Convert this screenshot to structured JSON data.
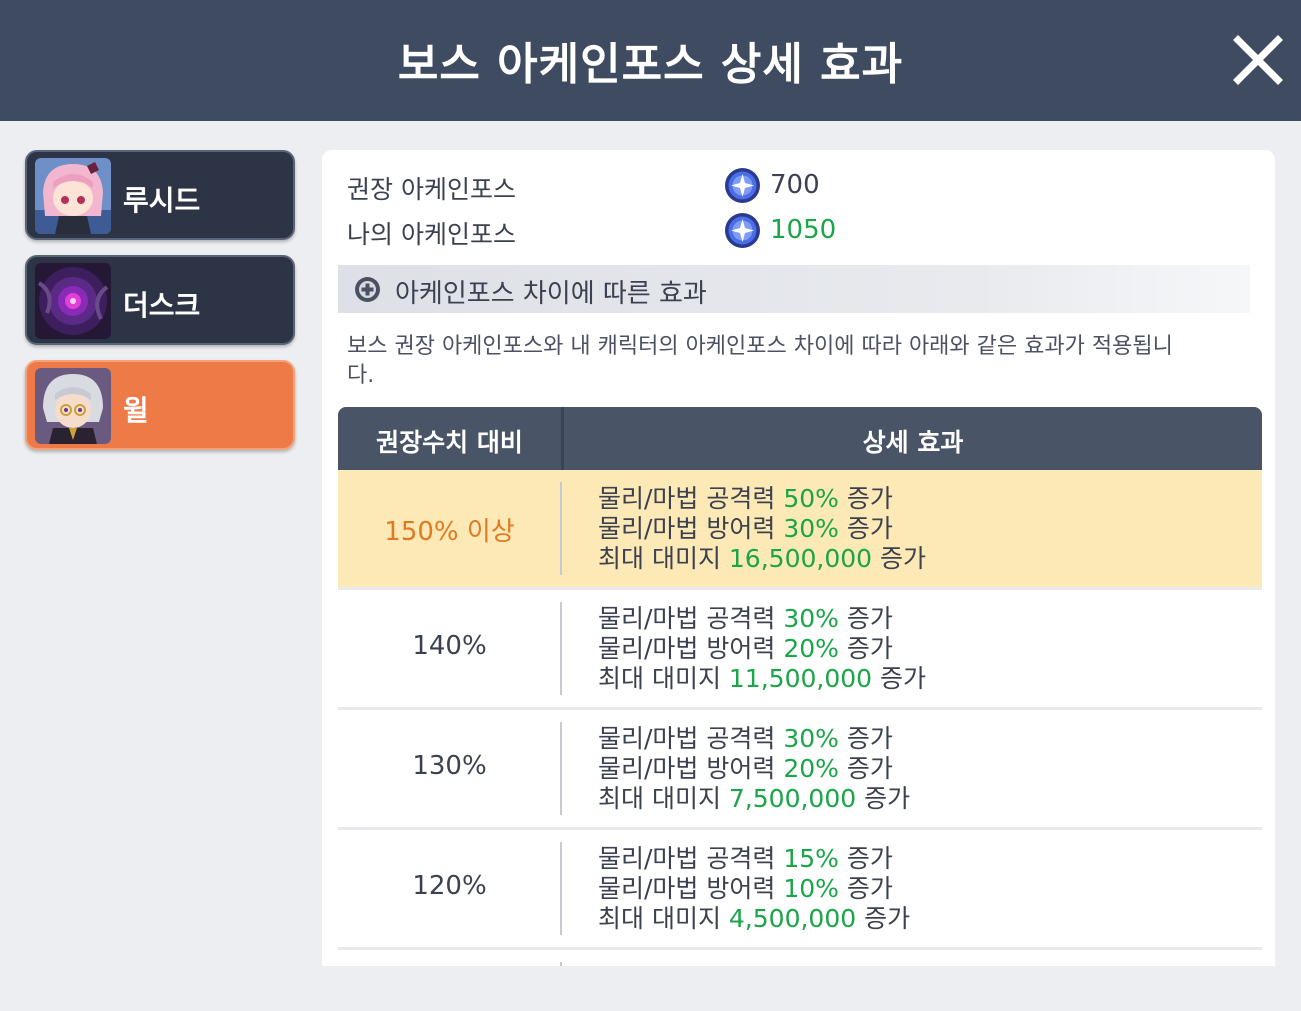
{
  "window": {
    "title": "보스 아케인포스 상세 효과"
  },
  "sidebar": {
    "tabs": [
      {
        "label": "루시드",
        "active": false
      },
      {
        "label": "더스크",
        "active": false
      },
      {
        "label": "윌",
        "active": true
      }
    ]
  },
  "info": {
    "recommended_label": "권장 아케인포스",
    "recommended_value": "700",
    "mine_label": "나의 아케인포스",
    "mine_value": "1050"
  },
  "section": {
    "title": "아케인포스 차이에 따른 효과",
    "description": "보스 권장 아케인포스와 내 캐릭터의 아케인포스 차이에 따라 아래와 같은 효과가 적용됩니다."
  },
  "table": {
    "headers": [
      "권장수치 대비",
      "상세 효과"
    ],
    "rows": [
      {
        "ratio": "150% 이상",
        "atk_label": "물리/마법 공격력",
        "atk": "50%",
        "def_label": "물리/마법 방어력",
        "def": "30%",
        "dmg_label": "최대 대미지",
        "dmg": "16,500,000",
        "suffix": "증가"
      },
      {
        "ratio": "140%",
        "atk_label": "물리/마법 공격력",
        "atk": "30%",
        "def_label": "물리/마법 방어력",
        "def": "20%",
        "dmg_label": "최대 대미지",
        "dmg": "11,500,000",
        "suffix": "증가"
      },
      {
        "ratio": "130%",
        "atk_label": "물리/마법 공격력",
        "atk": "30%",
        "def_label": "물리/마법 방어력",
        "def": "20%",
        "dmg_label": "최대 대미지",
        "dmg": "7,500,000",
        "suffix": "증가"
      },
      {
        "ratio": "120%",
        "atk_label": "물리/마법 공격력",
        "atk": "15%",
        "def_label": "물리/마법 방어력",
        "def": "10%",
        "dmg_label": "최대 대미지",
        "dmg": "4,500,000",
        "suffix": "증가"
      }
    ]
  },
  "colors": {
    "header_bg": "#3f4b60",
    "active_tab": "#ee7b47",
    "highlight_row": "#fde9b5",
    "value_green": "#1aa548",
    "highlight_ratio": "#e07a22"
  },
  "icons": {
    "close": "close-icon",
    "orb": "arcane-force-orb-icon",
    "bullet": "plus-circle-icon"
  }
}
